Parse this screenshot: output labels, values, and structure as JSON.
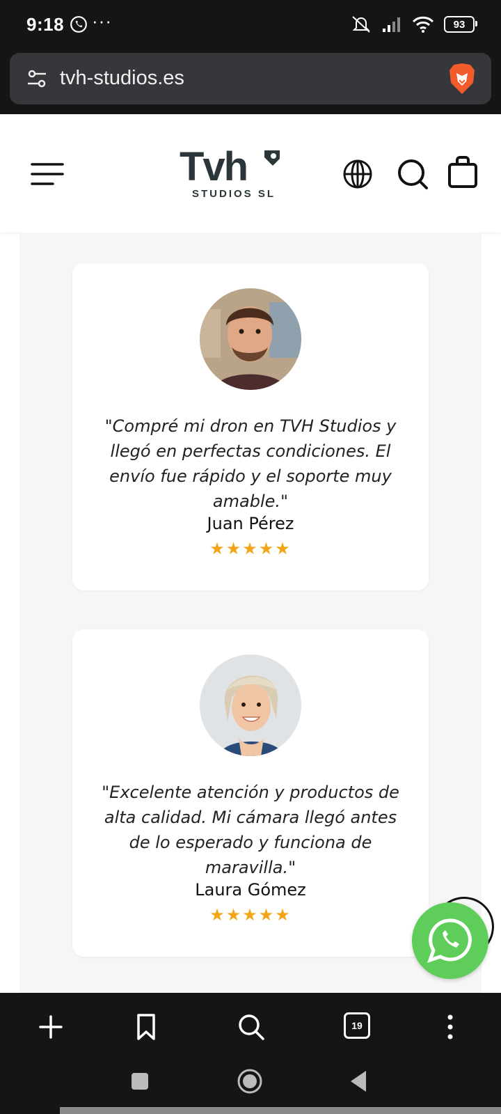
{
  "status": {
    "time": "9:18",
    "battery": "93"
  },
  "browser": {
    "url": "tvh-studios.es",
    "tab_count": "19"
  },
  "site": {
    "logo_main": "Tvh",
    "logo_sub": "STUDIOS SL"
  },
  "testimonials": [
    {
      "quote": "\"Compré mi dron en TVH Studios y llegó en perfectas condiciones. El envío fue rápido y el soporte muy amable.\"",
      "author": "Juan Pérez",
      "stars": "★★★★★",
      "rating": 5
    },
    {
      "quote": "\"Excelente atención y productos de alta calidad. Mi cámara llegó antes de lo esperado y funciona de maravilla.\"",
      "author": "Laura Gómez",
      "stars": "★★★★★",
      "rating": 5
    }
  ],
  "colors": {
    "star": "#f2a516",
    "whatsapp": "#5ecd5a",
    "logo": "#2b363b",
    "browser_chrome": "#151515"
  },
  "icons": [
    "whatsapp-icon",
    "mute-icon",
    "signal-icon",
    "wifi-icon",
    "tune-icon",
    "brave-icon",
    "menu-icon",
    "globe-icon",
    "search-icon",
    "bag-icon",
    "plus-icon",
    "bookmark-icon",
    "tabs-icon",
    "more-icon"
  ]
}
